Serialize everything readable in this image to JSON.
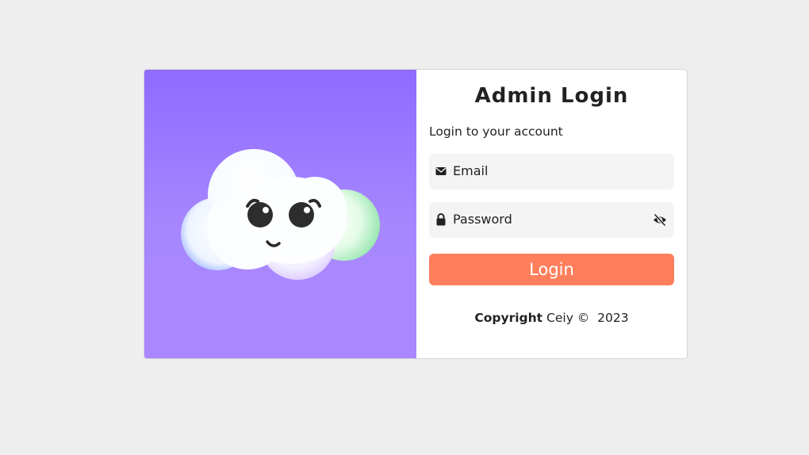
{
  "login": {
    "title": "Admin Login",
    "subtitle": "Login to your account",
    "email_placeholder": "Email",
    "email_icon": "envelope-icon",
    "password_placeholder": "Password",
    "password_icon": "lock-icon",
    "toggle_icon": "eye-slash-icon",
    "button_label": "Login",
    "button_color": "#ff7f5c"
  },
  "footer": {
    "copyright_label": "Copyright",
    "owner": "Ceiy ©",
    "year": "2023"
  },
  "illustration": {
    "name": "cloud-mascot",
    "background_color": "#9b78ff"
  }
}
